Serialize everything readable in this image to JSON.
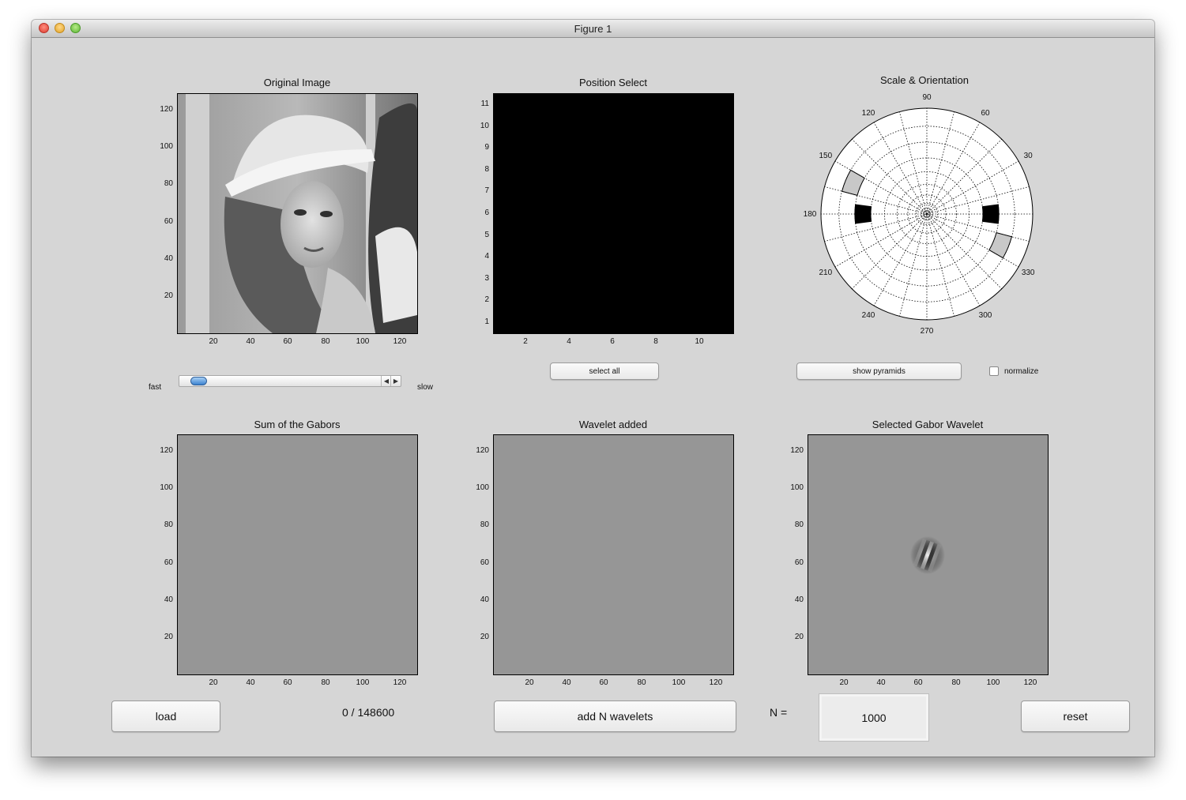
{
  "window": {
    "title": "Figure 1"
  },
  "axes": {
    "original": {
      "title": "Original Image",
      "yticks": [
        "120",
        "100",
        "80",
        "60",
        "40",
        "20"
      ],
      "xticks": [
        "20",
        "40",
        "60",
        "80",
        "100",
        "120"
      ]
    },
    "position": {
      "title": "Position Select",
      "yticks": [
        "11",
        "10",
        "9",
        "8",
        "7",
        "6",
        "5",
        "4",
        "3",
        "2",
        "1"
      ],
      "xticks": [
        "2",
        "4",
        "6",
        "8",
        "10"
      ]
    },
    "scale": {
      "title": "Scale & Orientation",
      "angles": [
        "90",
        "60",
        "30",
        "330",
        "300",
        "270",
        "240",
        "210",
        "180",
        "150",
        "120"
      ]
    },
    "sum": {
      "title": "Sum of the Gabors",
      "yticks": [
        "120",
        "100",
        "80",
        "60",
        "40",
        "20"
      ],
      "xticks": [
        "20",
        "40",
        "60",
        "80",
        "100",
        "120"
      ]
    },
    "added": {
      "title": "Wavelet added",
      "yticks": [
        "120",
        "100",
        "80",
        "60",
        "40",
        "20"
      ],
      "xticks": [
        "20",
        "40",
        "60",
        "80",
        "100",
        "120"
      ]
    },
    "selected": {
      "title": "Selected Gabor Wavelet",
      "yticks": [
        "120",
        "100",
        "80",
        "60",
        "40",
        "20"
      ],
      "xticks": [
        "20",
        "40",
        "60",
        "80",
        "100",
        "120"
      ]
    }
  },
  "controls": {
    "speed": {
      "fast_label": "fast",
      "slow_label": "slow",
      "value": 0.04
    },
    "select_all": "select all",
    "show_pyramids": "show pyramids",
    "normalize_label": "normalize",
    "load": "load",
    "counter": "0 / 148600",
    "add_n": "add N wavelets",
    "n_label": "N =",
    "n_value": "1000",
    "reset": "reset"
  },
  "colors": {
    "window_bg": "#d6d6d6",
    "plot_gray": "#969696",
    "selected_cell": "#000000",
    "highlight_cell": "#c8c8c8"
  }
}
